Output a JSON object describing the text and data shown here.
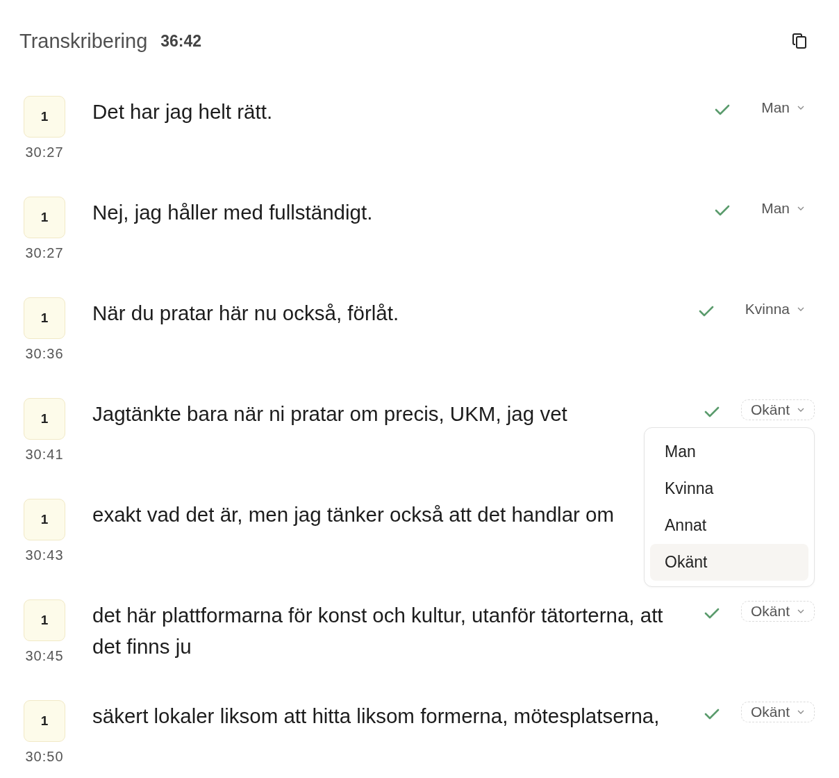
{
  "header": {
    "title": "Transkribering",
    "duration": "36:42"
  },
  "segments": [
    {
      "speaker_number": "1",
      "time": "30:27",
      "text": "Det har jag helt rätt.",
      "confirmed": true,
      "speaker": {
        "label": "Man",
        "outlined": false
      }
    },
    {
      "speaker_number": "1",
      "time": "30:27",
      "text": "Nej, jag håller med fullständigt.",
      "confirmed": true,
      "speaker": {
        "label": "Man",
        "outlined": false
      }
    },
    {
      "speaker_number": "1",
      "time": "30:36",
      "text": "När du pratar här nu också, förlåt.",
      "confirmed": true,
      "speaker": {
        "label": "Kvinna",
        "outlined": false
      }
    },
    {
      "speaker_number": "1",
      "time": "30:41",
      "text": "Jagtänkte bara när ni pratar om precis, UKM, jag vet",
      "confirmed": true,
      "speaker": {
        "label": "Okänt",
        "outlined": true,
        "menu": {
          "options": [
            {
              "label": "Man",
              "selected": false
            },
            {
              "label": "Kvinna",
              "selected": false
            },
            {
              "label": "Annat",
              "selected": false
            },
            {
              "label": "Okänt",
              "selected": true
            }
          ]
        }
      }
    },
    {
      "speaker_number": "1",
      "time": "30:43",
      "text": "exakt vad det är, men jag tänker också att det handlar om"
    },
    {
      "speaker_number": "1",
      "time": "30:45",
      "text": "det här plattformarna för konst och kultur, utanför tätorterna, att det finns ju",
      "confirmed": true,
      "speaker": {
        "label": "Okänt",
        "outlined": true
      }
    },
    {
      "speaker_number": "1",
      "time": "30:50",
      "text": "säkert lokaler liksom att hitta liksom formerna, mötesplatserna,",
      "confirmed": true,
      "speaker": {
        "label": "Okänt",
        "outlined": true
      }
    }
  ]
}
